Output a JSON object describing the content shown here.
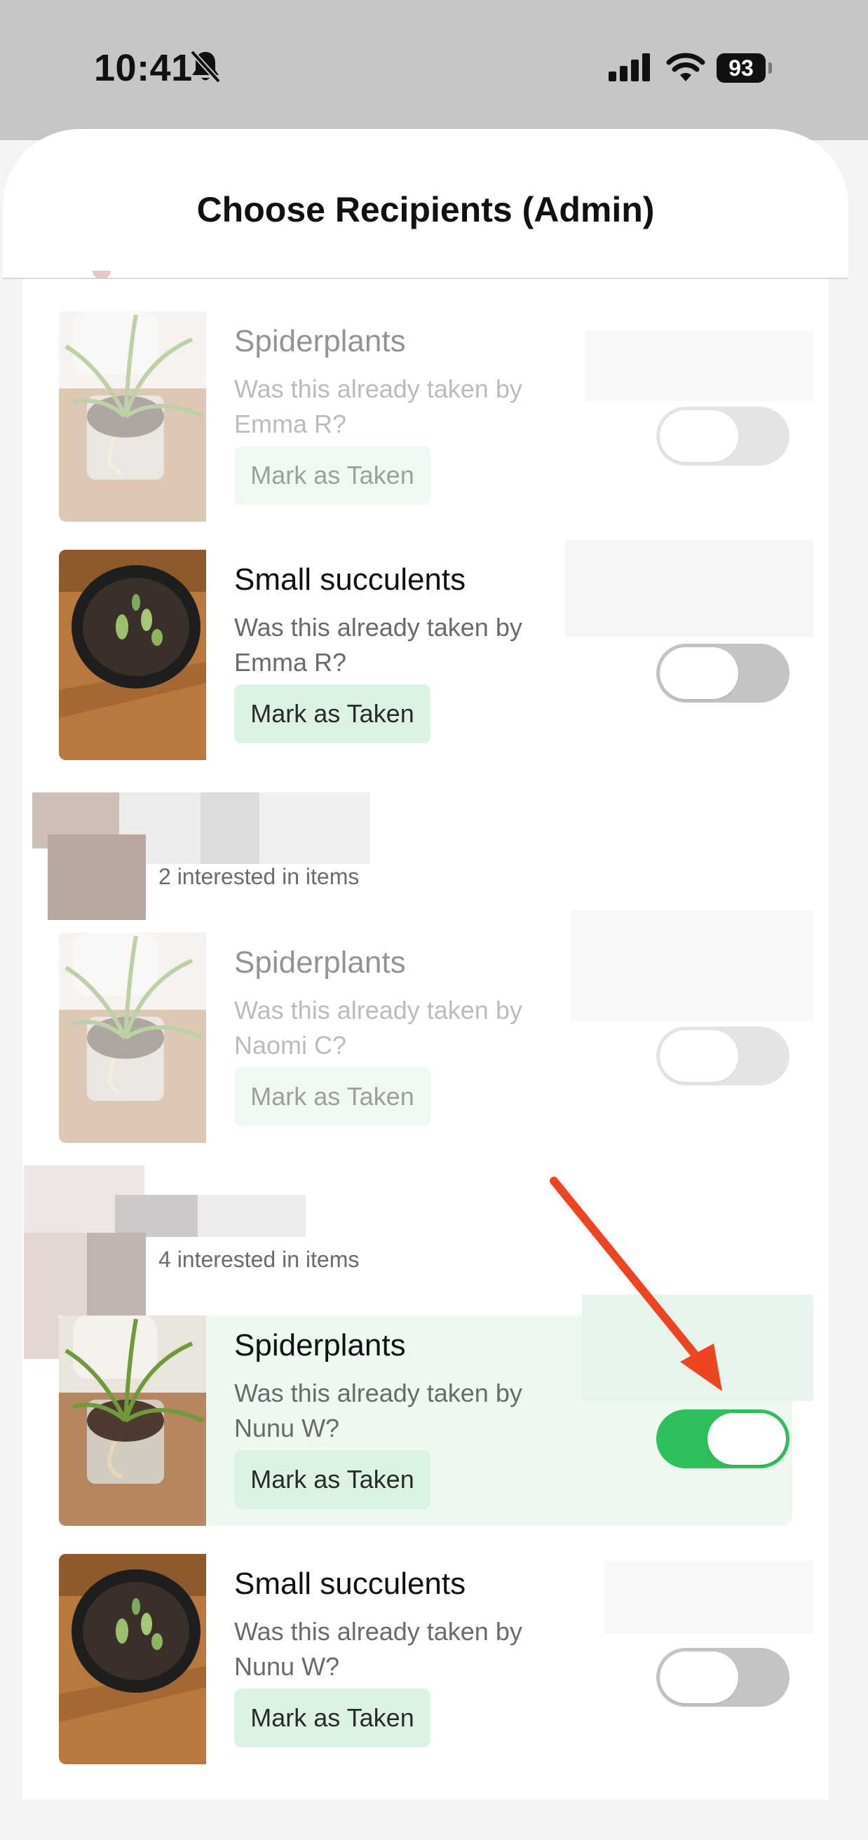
{
  "status_bar": {
    "time": "10:41",
    "battery": "93"
  },
  "sheet": {
    "title": "Choose Recipients (Admin)"
  },
  "groups": [
    {
      "label": "2 interested in items"
    },
    {
      "label": "4 interested in items"
    }
  ],
  "items": [
    {
      "name": "Spiderplants",
      "question": "Was this already taken by Emma R?",
      "button": "Mark as Taken",
      "toggle": "off",
      "disabled": true,
      "image": "spider-plant"
    },
    {
      "name": "Small succulents",
      "question": "Was this already taken by Emma R?",
      "button": "Mark as Taken",
      "toggle": "off",
      "disabled": false,
      "image": "succulents"
    },
    {
      "name": "Spiderplants",
      "question": "Was this already taken by Naomi C?",
      "button": "Mark as Taken",
      "toggle": "off",
      "disabled": true,
      "image": "spider-plant"
    },
    {
      "name": "Spiderplants",
      "question": "Was this already taken by Nunu W?",
      "button": "Mark as Taken",
      "toggle": "on",
      "disabled": false,
      "highlighted": true,
      "image": "spider-plant"
    },
    {
      "name": "Small succulents",
      "question": "Was this already taken by Nunu W?",
      "button": "Mark as Taken",
      "toggle": "off",
      "disabled": false,
      "image": "succulents"
    }
  ],
  "colors": {
    "accent_green": "#2fbf5a",
    "button_bg": "#dcf3e4",
    "annotation_arrow": "#ee4422"
  },
  "icons": [
    "bell-slash-icon",
    "signal-icon",
    "wifi-icon",
    "battery-icon",
    "annotation-arrow"
  ]
}
